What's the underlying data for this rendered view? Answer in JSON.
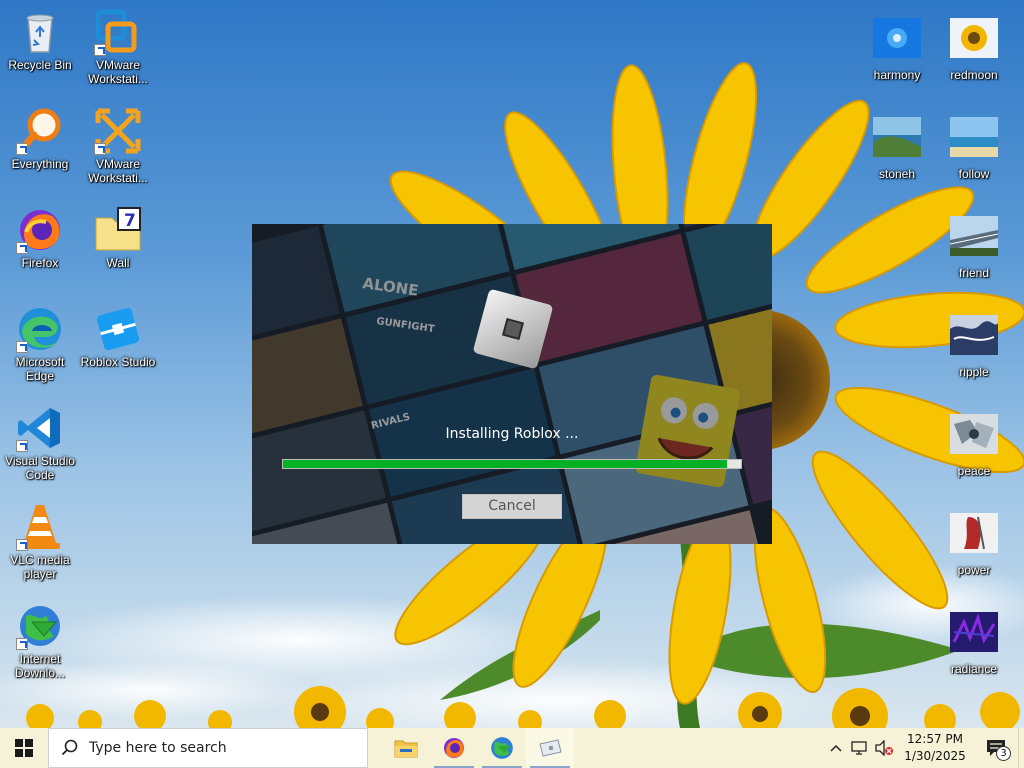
{
  "desktop": {
    "icons_left": [
      {
        "label": "Recycle Bin",
        "icon": "recycle-bin-icon",
        "shortcut": false
      },
      {
        "label": "VMware Workstati...",
        "icon": "vmware-icon",
        "shortcut": true
      },
      {
        "label": "Everything",
        "icon": "everything-search-icon",
        "shortcut": true
      },
      {
        "label": "VMware Workstati...",
        "icon": "vmware-orange-icon",
        "shortcut": true
      },
      {
        "label": "Firefox",
        "icon": "firefox-icon",
        "shortcut": true
      },
      {
        "label": "Wall",
        "icon": "wall-document-icon",
        "shortcut": false
      },
      {
        "label": "Microsoft Edge",
        "icon": "edge-icon",
        "shortcut": true
      },
      {
        "label": "Roblox Studio",
        "icon": "roblox-studio-icon",
        "shortcut": false
      },
      {
        "label": "Visual Studio Code",
        "icon": "vscode-icon",
        "shortcut": true
      },
      {
        "label": "VLC media player",
        "icon": "vlc-icon",
        "shortcut": true
      },
      {
        "label": "Internet Downlo...",
        "icon": "internet-download-manager-icon",
        "shortcut": true
      }
    ],
    "icons_right": [
      {
        "label": "harmony",
        "icon": "harmony-image-icon"
      },
      {
        "label": "redmoon",
        "icon": "redmoon-image-icon"
      },
      {
        "label": "stoneh",
        "icon": "stoneh-image-icon"
      },
      {
        "label": "follow",
        "icon": "follow-image-icon"
      },
      {
        "label": "friend",
        "icon": "friend-image-icon"
      },
      {
        "label": "ripple",
        "icon": "ripple-image-icon"
      },
      {
        "label": "peace",
        "icon": "peace-image-icon"
      },
      {
        "label": "power",
        "icon": "power-image-icon"
      },
      {
        "label": "radiance",
        "icon": "radiance-image-icon"
      }
    ]
  },
  "installer": {
    "status_text": "Installing Roblox ...",
    "progress": 0.97,
    "cancel_label": "Cancel",
    "progress_color": "#06b025",
    "art_tiles": [
      "ALONE",
      "GUNFIGHT",
      "RIVALS"
    ]
  },
  "taskbar": {
    "search_placeholder": "Type here to search",
    "apps": [
      {
        "name": "file-explorer",
        "icon": "folder-icon"
      },
      {
        "name": "firefox",
        "icon": "firefox-icon"
      },
      {
        "name": "internet-download-manager",
        "icon": "internet-download-manager-icon"
      },
      {
        "name": "roblox-installer",
        "icon": "roblox-installer-icon"
      }
    ],
    "clock_time": "12:57 PM",
    "clock_date": "1/30/2025",
    "notification_count": "3"
  },
  "colors": {
    "taskbar_bg": "#f6f2d8",
    "sunflower_yellow": "#f6c400",
    "sky_blue": "#3f86c9"
  }
}
